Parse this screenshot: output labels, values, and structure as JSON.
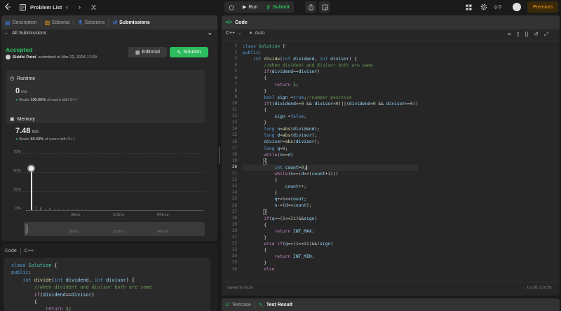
{
  "topbar": {
    "problem_list": "Problem List",
    "run": "Run",
    "submit": "Submit",
    "coins": "0",
    "premium": "Premium"
  },
  "left": {
    "tabs": [
      "Description",
      "Editorial",
      "Solutions",
      "Submissions"
    ],
    "all_submissions": "All Submissions",
    "status": "Accepted",
    "user": "Siddhi Patni",
    "submitted": "submitted at Mar 22, 2024 17:00",
    "editorial_btn": "Editorial",
    "solution_btn": "Solution",
    "runtime": {
      "title": "Runtime",
      "value": "0",
      "unit": "ms",
      "beats_prefix": "Beats",
      "beats_value": "100.00%",
      "beats_suffix": "of users with C++"
    },
    "memory": {
      "title": "Memory",
      "value": "7.48",
      "unit": "MB",
      "beats_prefix": "Beats",
      "beats_value": "90.43%",
      "beats_suffix": "of users with C++"
    },
    "chart_y_ticks": [
      "75%",
      "50%",
      "25%",
      "0%"
    ],
    "chart_x_ticks": [
      "36ms",
      "513ms",
      "841ms"
    ],
    "mini_x_ticks": [
      "36ms",
      "513ms",
      "841ms"
    ],
    "code_label": "Code",
    "code_lang": "C++",
    "code_lines": [
      "class Solution {",
      "public:",
      "    int divide(int dividend, int divisor) {",
      "        //when divident and divisor both are same",
      "        if(dividend==divisor)",
      "        {",
      "            return 1;"
    ]
  },
  "chart_data": {
    "type": "bar",
    "title": "",
    "xlabel": "",
    "ylabel": "",
    "x_ticks": [
      "36ms",
      "513ms",
      "841ms"
    ],
    "y_ticks": [
      "0%",
      "25%",
      "50%",
      "75%"
    ],
    "ylim": [
      0,
      75
    ],
    "highlight": {
      "x": "0ms",
      "y": 50
    },
    "values": [
      50,
      6,
      4,
      2,
      3,
      1.5,
      1,
      1,
      0.8,
      0.6,
      0.6,
      0.5,
      0.5,
      0.4,
      0.4,
      0.3,
      0.3,
      0.3,
      0.3,
      0.3
    ]
  },
  "editor": {
    "title": "Code",
    "language": "C++",
    "mode": "Auto",
    "saved": "Saved to local",
    "cursor": "Ln 20, Col 25",
    "line_numbers": [
      "1",
      "2",
      "3",
      "4",
      "5",
      "6",
      "7",
      "8",
      "9",
      "10",
      "11",
      "12",
      "13",
      "14",
      "15",
      "16",
      "17",
      "18",
      "19",
      "20",
      "21",
      "22",
      "23",
      "24",
      "25",
      "26",
      "27",
      "28",
      "29",
      "30",
      "31",
      "32",
      "33",
      "34",
      "35",
      "36"
    ]
  },
  "bottom": {
    "testcase": "Testcase",
    "test_result": "Test Result"
  },
  "colors": {
    "accepted": "#2cbb5d",
    "brand": "#ffa116",
    "submit": "#2cbb5d"
  }
}
